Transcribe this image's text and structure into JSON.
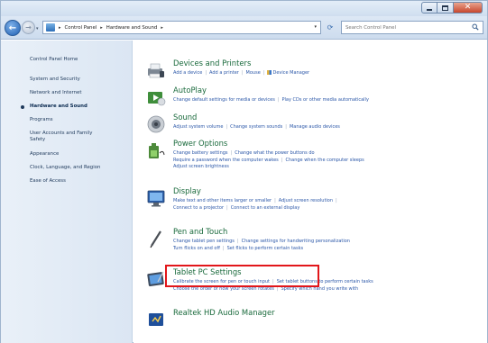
{
  "window": {
    "colors": {
      "highlight": "#e2161a",
      "link": "#2b57a8",
      "category_title": "#1a6a3c",
      "close_button": "#c7462d"
    }
  },
  "address_bar": {
    "breadcrumbs": [
      "Control Panel",
      "Hardware and Sound"
    ]
  },
  "search": {
    "placeholder": "Search Control Panel"
  },
  "left_nav": {
    "home": "Control Panel Home",
    "items": [
      "System and Security",
      "Network and Internet",
      "Hardware and Sound",
      "Programs",
      "User Accounts and Family Safety",
      "Appearance",
      "Clock, Language, and Region",
      "Ease of Access"
    ],
    "current_item": "Hardware and Sound"
  },
  "categories": [
    {
      "title": "Devices and Printers",
      "icon": "printer-icon",
      "links": [
        "Add a device",
        "Add a printer",
        "Mouse",
        "Device Manager"
      ]
    },
    {
      "title": "AutoPlay",
      "icon": "autoplay-icon",
      "links": [
        "Change default settings for media or devices",
        "Play CDs or other media automatically"
      ]
    },
    {
      "title": "Sound",
      "icon": "speaker-icon",
      "links": [
        "Adjust system volume",
        "Change system sounds",
        "Manage audio devices"
      ]
    },
    {
      "title": "Power Options",
      "icon": "battery-icon",
      "links": [
        "Change battery settings",
        "Change what the power buttons do",
        "Require a password when the computer wakes",
        "Change when the computer sleeps",
        "Adjust screen brightness"
      ]
    },
    {
      "title": "Display",
      "icon": "display-icon",
      "links": [
        "Make text and other items larger or smaller",
        "Adjust screen resolution",
        "Connect to a projector",
        "Connect to an external display"
      ]
    },
    {
      "title": "Pen and Touch",
      "icon": "pen-icon",
      "links": [
        "Change tablet pen settings",
        "Change settings for handwriting personalization",
        "Turn flicks on and off",
        "Set flicks to perform certain tasks"
      ]
    },
    {
      "title": "Tablet PC Settings",
      "icon": "tablet-icon",
      "links": [
        "Calibrate the screen for pen or touch input",
        "Set tablet buttons to perform certain tasks",
        "Choose the order of how your screen rotates",
        "Specify which hand you write with"
      ]
    },
    {
      "title": "Realtek HD Audio Manager",
      "icon": "audio-manager-icon",
      "links": []
    }
  ]
}
